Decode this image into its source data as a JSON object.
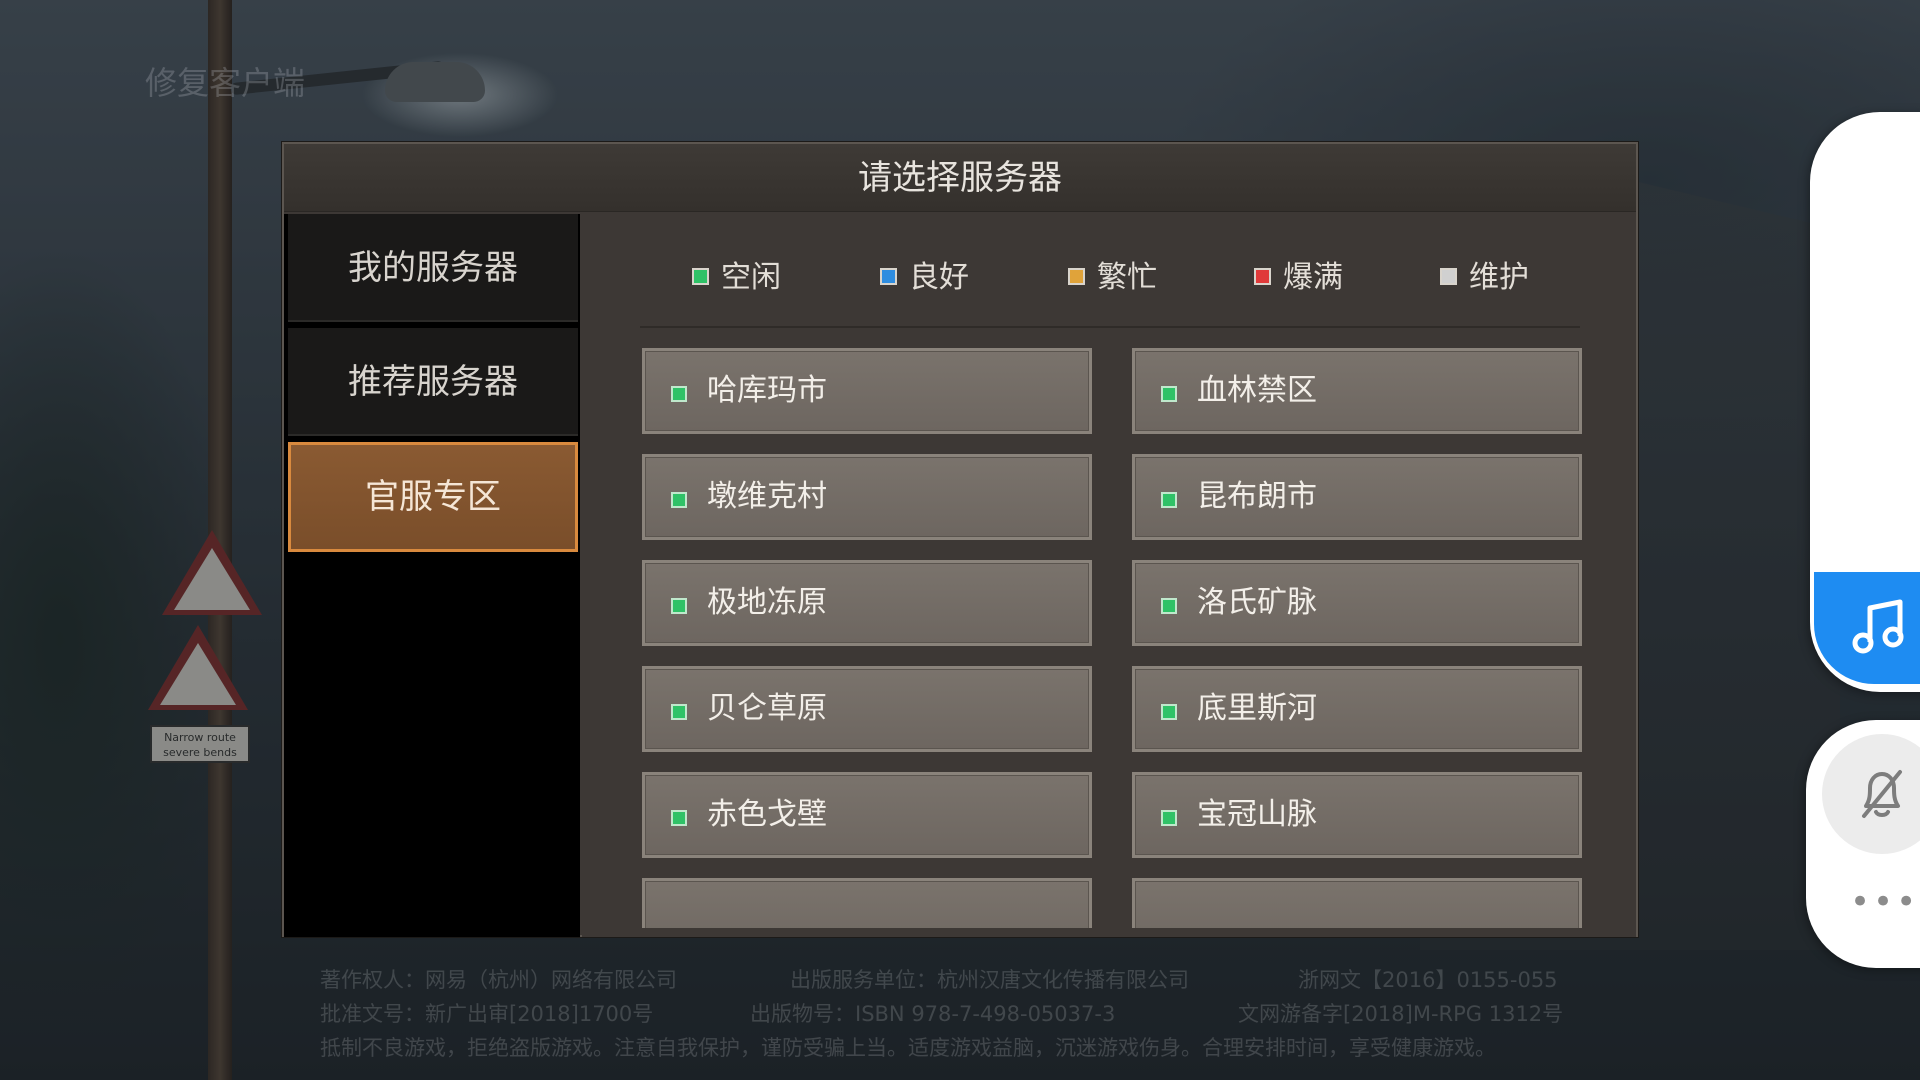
{
  "background": {
    "watermark": "修复客户端",
    "sign_text": "Narrow route severe bends"
  },
  "dialog": {
    "title": "请选择服务器",
    "side_menu": [
      {
        "label": "我的服务器",
        "active": false
      },
      {
        "label": "推荐服务器",
        "active": false
      },
      {
        "label": "官服专区",
        "active": true
      }
    ],
    "legend": [
      {
        "label": "空闲",
        "color": "#2fc267"
      },
      {
        "label": "良好",
        "color": "#2f8de0"
      },
      {
        "label": "繁忙",
        "color": "#e0a33a"
      },
      {
        "label": "爆满",
        "color": "#e03a3a"
      },
      {
        "label": "维护",
        "color": "#d0d0d0"
      }
    ],
    "servers": [
      {
        "name": "哈库玛市",
        "status": "空闲"
      },
      {
        "name": "血林禁区",
        "status": "空闲"
      },
      {
        "name": "墩维克村",
        "status": "空闲"
      },
      {
        "name": "昆布朗市",
        "status": "空闲"
      },
      {
        "name": "极地冻原",
        "status": "空闲"
      },
      {
        "name": "洛氏矿脉",
        "status": "空闲"
      },
      {
        "name": "贝仑草原",
        "status": "空闲"
      },
      {
        "name": "底里斯河",
        "status": "空闲"
      },
      {
        "name": "赤色戈壁",
        "status": "空闲"
      },
      {
        "name": "宝冠山脉",
        "status": "空闲"
      }
    ]
  },
  "footer": {
    "line1_left": "著作权人：网易（杭州）网络有限公司",
    "line1_mid": "出版服务单位：杭州汉唐文化传播有限公司",
    "line1_right": "浙网文【2016】0155-055",
    "line2_left": "批准文号：新广出审[2018]1700号",
    "line2_mid": "出版物号：ISBN 978-7-498-05037-3",
    "line2_right": "文网游备字[2018]M-RPG 1312号",
    "line3": "抵制不良游戏，拒绝盗版游戏。注意自我保护，谨防受骗上当。适度游戏益脑，沉迷游戏伤身。合理安排时间，享受健康游戏。"
  },
  "float_panel": {
    "music_icon": "music-note-icon",
    "bell_icon": "bell-off-icon",
    "more_icon": "more-dots-icon",
    "accent": "#1e8cf2"
  }
}
